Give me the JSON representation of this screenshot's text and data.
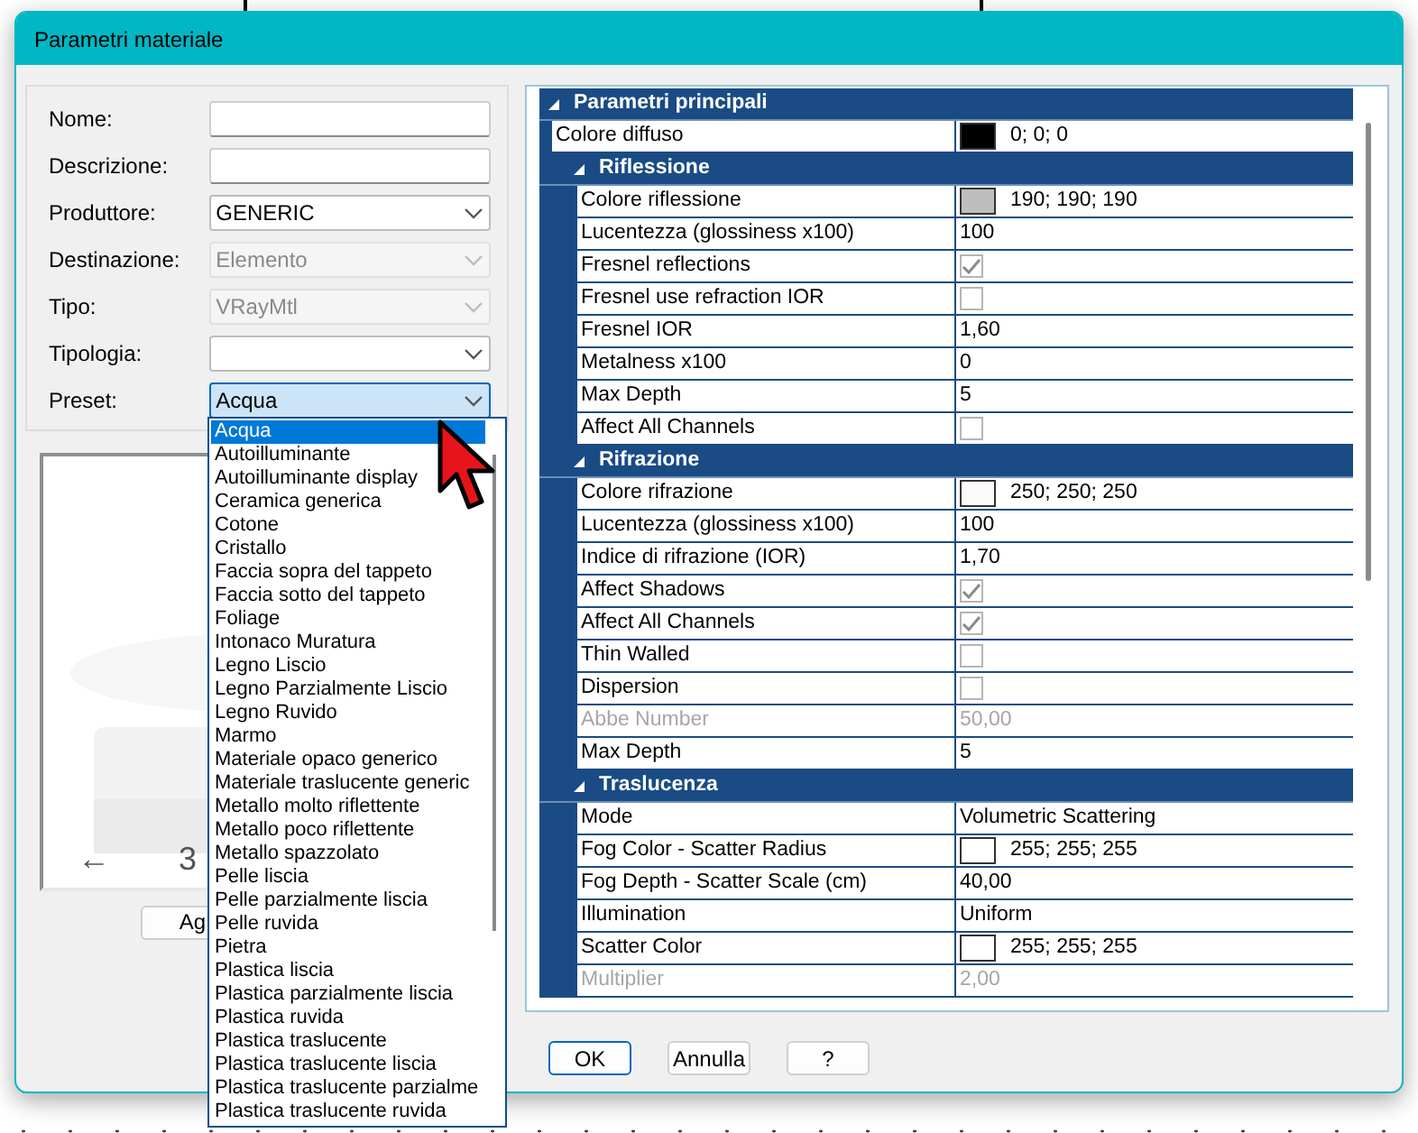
{
  "window": {
    "title": "Parametri materiale"
  },
  "form": [
    {
      "label": "Nome:",
      "kind": "text",
      "disabled": false,
      "open": false
    },
    {
      "label": "Descrizione:",
      "kind": "text",
      "disabled": false,
      "open": false
    },
    {
      "label": "Produttore:",
      "kind": "select",
      "value": "GENERIC",
      "disabled": false,
      "open": false
    },
    {
      "label": "Destinazione:",
      "kind": "select",
      "value": "Elemento",
      "disabled": true,
      "open": false
    },
    {
      "label": "Tipo:",
      "kind": "select",
      "value": "VRayMtl",
      "disabled": true,
      "open": false
    },
    {
      "label": "Tipologia:",
      "kind": "select",
      "disabled": false,
      "open": false
    },
    {
      "label": "Preset:",
      "kind": "select",
      "value": "Acqua",
      "disabled": false,
      "open": true
    }
  ],
  "preview": {
    "arrow": "←",
    "counter": "3",
    "button": "Ag"
  },
  "preset_list": [
    {
      "label": "Acqua",
      "selected": true
    },
    {
      "label": "Autoilluminante",
      "selected": false
    },
    {
      "label": "Autoilluminante display",
      "selected": false
    },
    {
      "label": "Ceramica generica",
      "selected": false
    },
    {
      "label": "Cotone",
      "selected": false
    },
    {
      "label": "Cristallo",
      "selected": false
    },
    {
      "label": "Faccia sopra del tappeto",
      "selected": false
    },
    {
      "label": "Faccia sotto del tappeto",
      "selected": false
    },
    {
      "label": "Foliage",
      "selected": false
    },
    {
      "label": "Intonaco Muratura",
      "selected": false
    },
    {
      "label": "Legno Liscio",
      "selected": false
    },
    {
      "label": "Legno Parzialmente Liscio",
      "selected": false
    },
    {
      "label": "Legno Ruvido",
      "selected": false
    },
    {
      "label": "Marmo",
      "selected": false
    },
    {
      "label": "Materiale opaco generico",
      "selected": false
    },
    {
      "label": "Materiale traslucente generic",
      "selected": false
    },
    {
      "label": "Metallo molto riflettente",
      "selected": false
    },
    {
      "label": "Metallo poco riflettente",
      "selected": false
    },
    {
      "label": "Metallo spazzolato",
      "selected": false
    },
    {
      "label": "Pelle liscia",
      "selected": false
    },
    {
      "label": "Pelle parzialmente liscia",
      "selected": false
    },
    {
      "label": "Pelle ruvida",
      "selected": false
    },
    {
      "label": "Pietra",
      "selected": false
    },
    {
      "label": "Plastica liscia",
      "selected": false
    },
    {
      "label": "Plastica parzialmente liscia",
      "selected": false
    },
    {
      "label": "Plastica ruvida",
      "selected": false
    },
    {
      "label": "Plastica traslucente",
      "selected": false
    },
    {
      "label": "Plastica traslucente liscia",
      "selected": false
    },
    {
      "label": "Plastica traslucente parzialme",
      "selected": false
    },
    {
      "label": "Plastica traslucente ruvida",
      "selected": false
    }
  ],
  "properties": {
    "title": "Parametri principali",
    "expanded": true,
    "rows": [
      {
        "kind": "color",
        "label": "Colore diffuso",
        "color": "#000000",
        "value": "0; 0; 0",
        "disabled": false
      }
    ],
    "sections": [
      {
        "title": "Riflessione",
        "expanded": true,
        "rows": [
          {
            "kind": "color",
            "label": "Colore riflessione",
            "color": "#bebebe",
            "value": "190; 190; 190",
            "disabled": false
          },
          {
            "kind": "text",
            "label": "Lucentezza (glossiness x100)",
            "value": "100",
            "disabled": false
          },
          {
            "kind": "check",
            "label": "Fresnel reflections",
            "checked": true,
            "disabled": false
          },
          {
            "kind": "check",
            "label": "Fresnel use refraction IOR",
            "checked": false,
            "disabled": false
          },
          {
            "kind": "text",
            "label": "Fresnel IOR",
            "value": "1,60",
            "disabled": false
          },
          {
            "kind": "text",
            "label": "Metalness x100",
            "value": "0",
            "disabled": false
          },
          {
            "kind": "text",
            "label": "Max Depth",
            "value": "5",
            "disabled": false
          },
          {
            "kind": "check",
            "label": "Affect All Channels",
            "checked": false,
            "disabled": false
          }
        ]
      },
      {
        "title": "Rifrazione",
        "expanded": true,
        "rows": [
          {
            "kind": "color",
            "label": "Colore rifrazione",
            "color": "#fafafa",
            "value": "250; 250; 250",
            "disabled": false
          },
          {
            "kind": "text",
            "label": "Lucentezza (glossiness x100)",
            "value": "100",
            "disabled": false
          },
          {
            "kind": "text",
            "label": "Indice di rifrazione (IOR)",
            "value": "1,70",
            "disabled": false
          },
          {
            "kind": "check",
            "label": "Affect Shadows",
            "checked": true,
            "disabled": false
          },
          {
            "kind": "check",
            "label": "Affect All Channels",
            "checked": true,
            "disabled": false
          },
          {
            "kind": "check",
            "label": "Thin Walled",
            "checked": false,
            "disabled": false
          },
          {
            "kind": "check",
            "label": "Dispersion",
            "checked": false,
            "disabled": false
          },
          {
            "kind": "text",
            "label": "Abbe Number",
            "value": "50,00",
            "disabled": true
          },
          {
            "kind": "text",
            "label": "Max Depth",
            "value": "5",
            "disabled": false
          }
        ]
      },
      {
        "title": "Traslucenza",
        "expanded": true,
        "rows": [
          {
            "kind": "text",
            "label": "Mode",
            "value": "Volumetric Scattering",
            "disabled": false
          },
          {
            "kind": "color",
            "label": "Fog Color - Scatter Radius",
            "color": "#ffffff",
            "value": "255; 255; 255",
            "disabled": false
          },
          {
            "kind": "text",
            "label": "Fog Depth - Scatter Scale (cm)",
            "value": "40,00",
            "disabled": false
          },
          {
            "kind": "text",
            "label": "Illumination",
            "value": "Uniform",
            "disabled": false
          },
          {
            "kind": "color",
            "label": "Scatter Color",
            "color": "#ffffff",
            "value": "255; 255; 255",
            "disabled": false
          },
          {
            "kind": "text",
            "label": "Multiplier",
            "value": "2,00",
            "disabled": true
          }
        ]
      }
    ]
  },
  "buttons": [
    "OK",
    "Annulla",
    "?"
  ]
}
